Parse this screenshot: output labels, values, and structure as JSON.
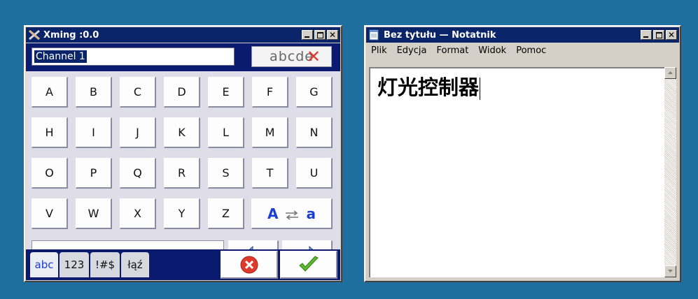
{
  "xming": {
    "title": "Xming :0.0",
    "channel_value": "Channel 1",
    "mode_label": "abcde",
    "keys": [
      [
        "A",
        "B",
        "C",
        "D",
        "E",
        "F",
        "G"
      ],
      [
        "H",
        "I",
        "J",
        "K",
        "L",
        "M",
        "N"
      ],
      [
        "O",
        "P",
        "Q",
        "R",
        "S",
        "T",
        "U"
      ],
      [
        "V",
        "W",
        "X",
        "Y",
        "Z"
      ]
    ],
    "case_toggle": {
      "upper": "A",
      "lower": "a"
    },
    "tabs": [
      "abc",
      "123",
      "!#$",
      "łąź"
    ],
    "active_tab": "abc",
    "colors": {
      "strip": "#0a1a6e",
      "accent": "#1a3fd0",
      "cancel": "#e0392b",
      "ok": "#5cb82e"
    }
  },
  "notepad": {
    "title": "Bez tytułu — Notatnik",
    "menu": [
      "Plik",
      "Edycja",
      "Format",
      "Widok",
      "Pomoc"
    ],
    "content": "灯光控制器"
  }
}
